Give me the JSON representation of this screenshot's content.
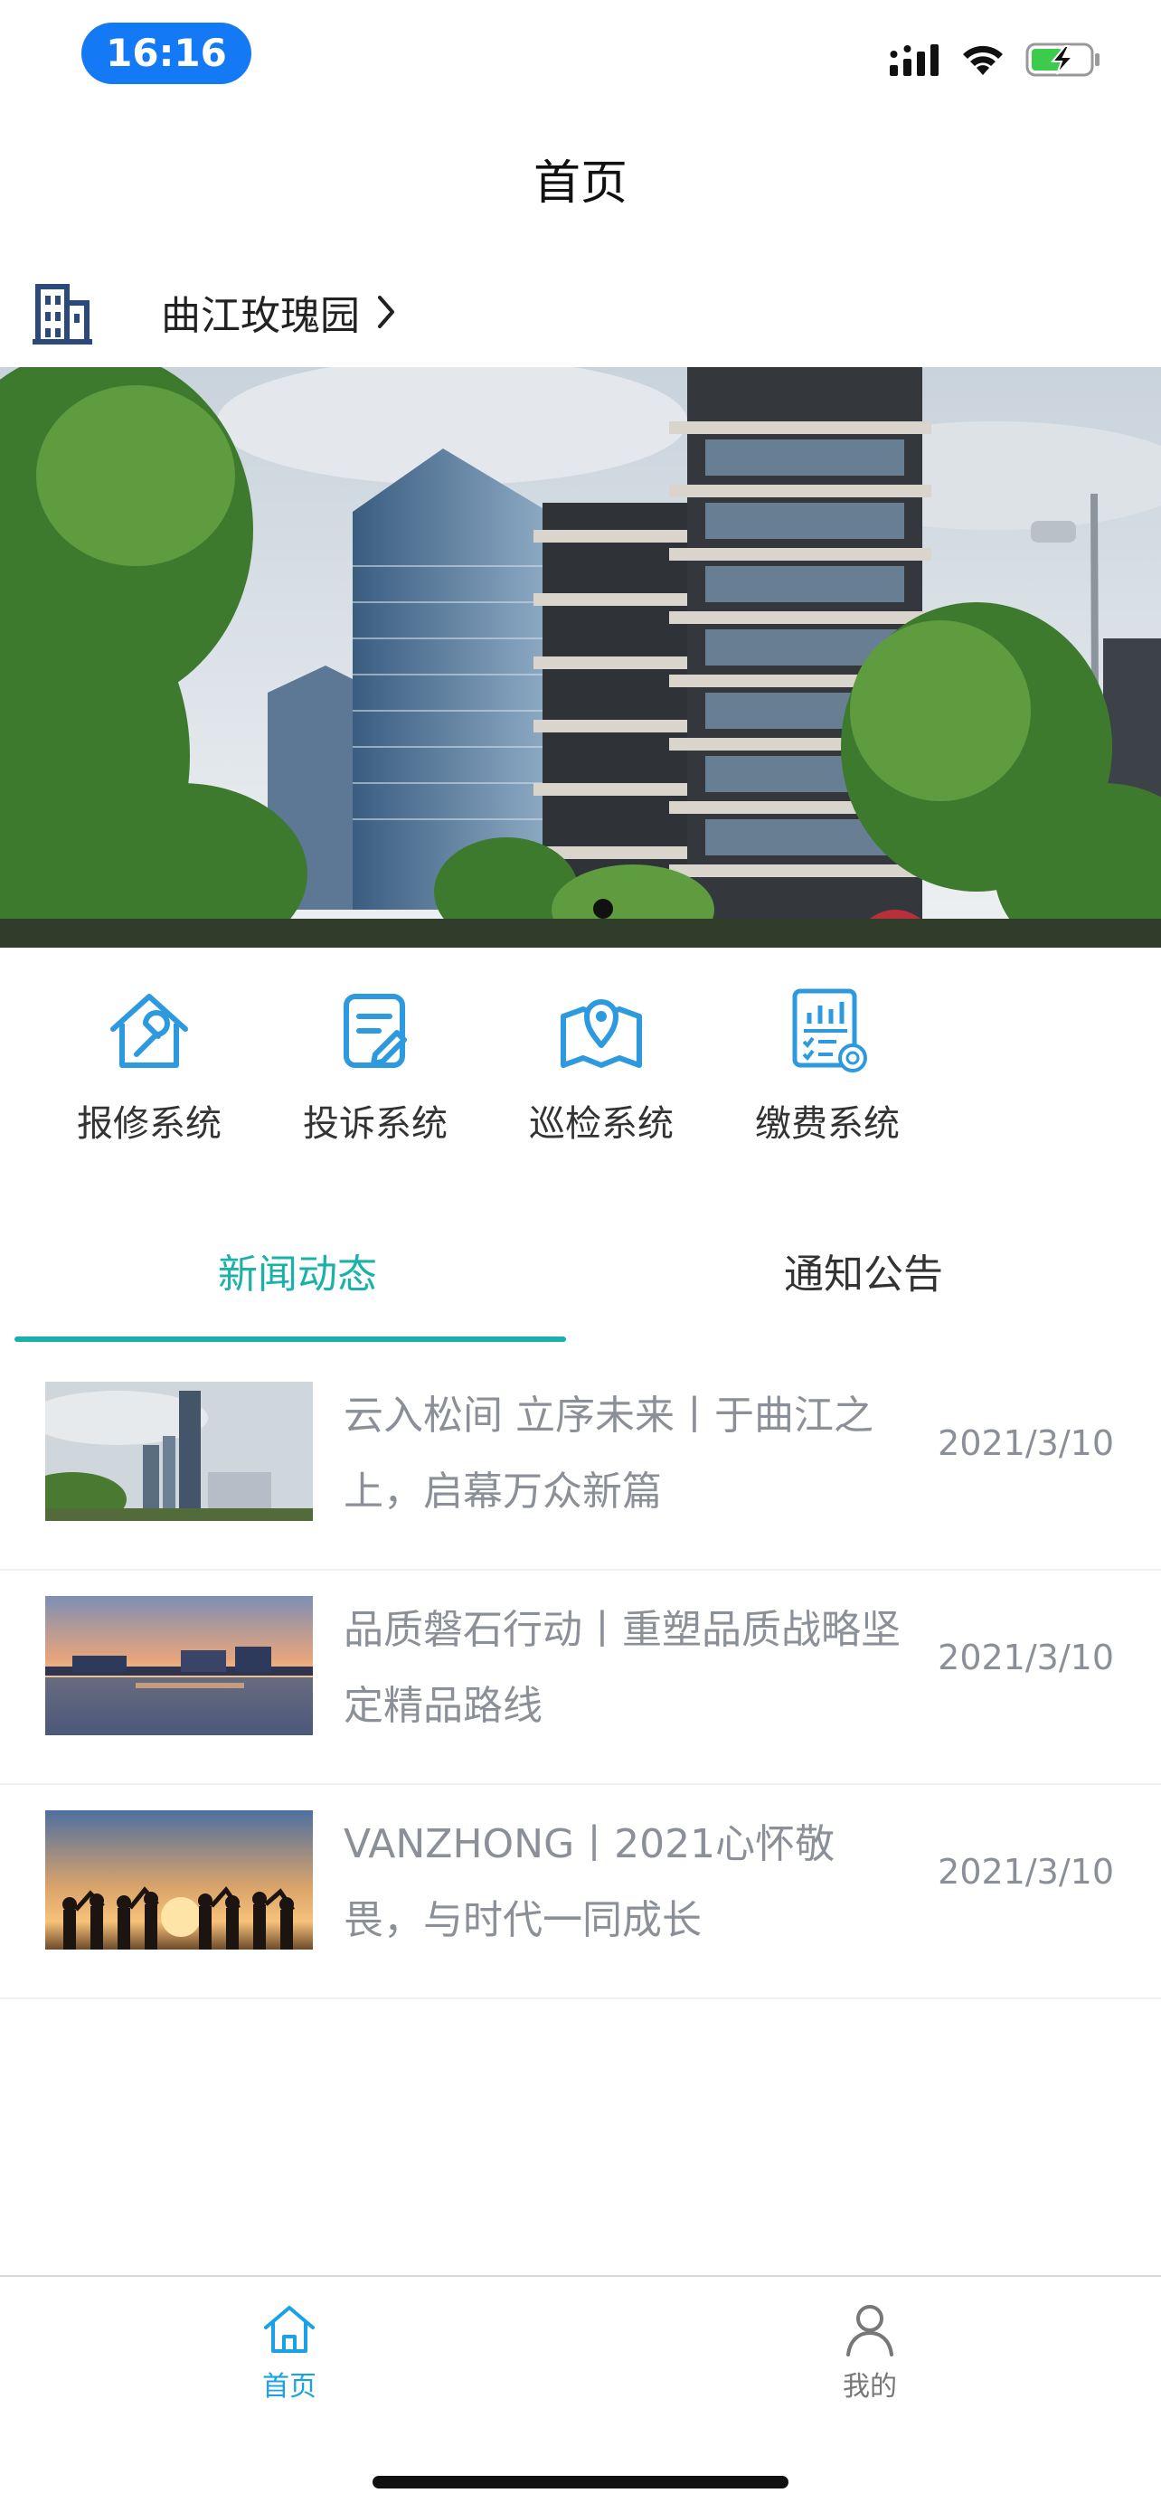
{
  "status_bar": {
    "time": "16:16"
  },
  "nav": {
    "title": "首页"
  },
  "community": {
    "name": "曲江玫瑰园",
    "icon": "building-icon"
  },
  "banner": {
    "image": "high-rise buildings",
    "active_dot": 1
  },
  "quick_entries": [
    {
      "label": "报修系统",
      "icon": "repair-house-icon"
    },
    {
      "label": "投诉系统",
      "icon": "complaint-edit-icon"
    },
    {
      "label": "巡检系统",
      "icon": "patrol-map-icon"
    },
    {
      "label": "缴费系统",
      "icon": "payment-report-icon"
    }
  ],
  "tabs": [
    {
      "label": "新闻动态",
      "active": true
    },
    {
      "label": "通知公告",
      "active": false
    }
  ],
  "news": [
    {
      "title": "云入松间 立序未来丨于曲江之上，启幕万众新篇",
      "date": "2021/3/10"
    },
    {
      "title": "品质磐石行动丨重塑品质战略坚定精品路线",
      "date": "2021/3/10"
    },
    {
      "title": "VANZHONG丨2021心怀敬畏，与时代一同成长",
      "date": "2021/3/10"
    }
  ],
  "tabbar": [
    {
      "label": "首页",
      "icon": "home-icon",
      "active": true
    },
    {
      "label": "我的",
      "icon": "user-icon",
      "active": false
    }
  ],
  "colors": {
    "accent": "#1ab2a8",
    "icon_blue": "#2d9ae0",
    "time_pill": "#1479f5",
    "muted_text": "#8a8f98"
  }
}
